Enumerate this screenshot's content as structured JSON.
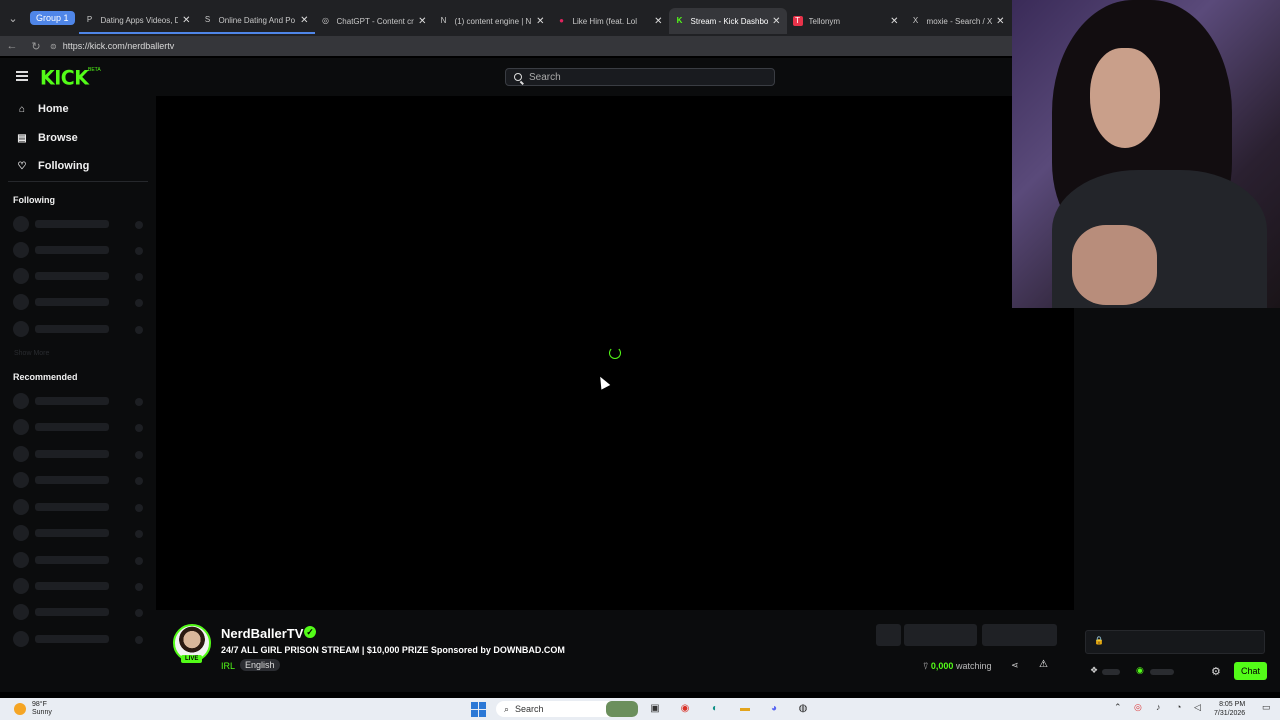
{
  "browser": {
    "group_label": "Group 1",
    "tabs": [
      {
        "title": "Dating Apps Videos, D",
        "fav_color": "#888888",
        "fav": "P"
      },
      {
        "title": "Online Dating And Po",
        "fav_color": "#888888",
        "fav": "S"
      },
      {
        "title": "ChatGPT - Content cre",
        "fav_color": "#888888",
        "fav": "◎"
      },
      {
        "title": "(1) content engine | N",
        "fav_color": "#ffffff",
        "fav": "N"
      },
      {
        "title": "Like Him (feat. Lol",
        "fav_color": "#e0245e",
        "fav": "●"
      },
      {
        "title": "Stream - Kick Dashboa",
        "fav_color": "#53fc18",
        "fav": "K"
      },
      {
        "title": "Tellonym",
        "fav_color": "#e8334a",
        "fav": "T"
      },
      {
        "title": "moxie - Search / X",
        "fav_color": "#ffffff",
        "fav": "X"
      }
    ],
    "url": "https://kick.com/nerdballertv"
  },
  "header": {
    "logo": "KICK",
    "beta": "BETA",
    "search_placeholder": "Search"
  },
  "sidebar": {
    "nav": [
      {
        "label": "Home",
        "icon": "home-icon",
        "glyph": "⌂"
      },
      {
        "label": "Browse",
        "icon": "browse-icon",
        "glyph": "▤"
      },
      {
        "label": "Following",
        "icon": "heart-icon",
        "glyph": "♡"
      }
    ],
    "following_title": "Following",
    "show_more": "Show More",
    "recommended_title": "Recommended"
  },
  "stream": {
    "name": "NerdBallerTV",
    "title": "24/7 ALL GIRL PRISON STREAM | $10,000 PRIZE Sponsored by DOWNBAD.COM",
    "category": "IRL",
    "language": "English",
    "live_badge": "LIVE",
    "watching_count": "0,000",
    "watching_label": "watching"
  },
  "chat": {
    "button_label": "Chat"
  },
  "taskbar": {
    "temp": "98°F",
    "condition": "Sunny",
    "search_label": "Search",
    "time": "8:05 PM",
    "date": "7/31/2026"
  },
  "colors": {
    "accent": "#53fc18",
    "background": "#0b0c0d"
  }
}
